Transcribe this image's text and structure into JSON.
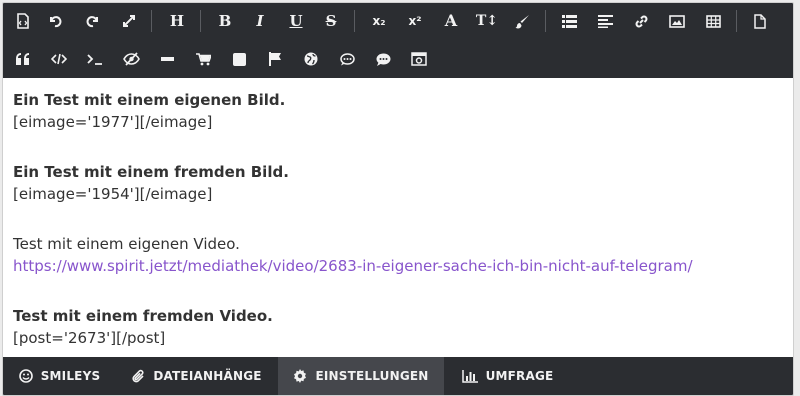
{
  "toolbar": {
    "heading_label": "H",
    "bold_label": "B",
    "italic_label": "I",
    "underline_label": "U",
    "strike_label": "S",
    "subscript_label": "x₂",
    "superscript_label": "x²",
    "font_size_label": "A",
    "text_size_label": "T↕",
    "icons_row1": [
      "source-icon",
      "undo-icon",
      "redo-icon",
      "fullscreen-icon",
      "heading-icon",
      "bold-icon",
      "italic-icon",
      "underline-icon",
      "strikethrough-icon",
      "subscript-icon",
      "superscript-icon",
      "font-size-icon",
      "text-height-icon",
      "paint-brush-icon",
      "list-icon",
      "align-left-icon",
      "link-icon",
      "image-icon",
      "table-icon",
      "page-icon"
    ],
    "icons_row2": [
      "quote-icon",
      "code-icon",
      "terminal-icon",
      "spoiler-eye-slash-icon",
      "horizontal-rule-icon",
      "shopping-cart-icon",
      "square-icon",
      "flag-icon",
      "globe-icon",
      "comment-dots-icon",
      "comment-icon",
      "media-icon"
    ]
  },
  "content": {
    "line1": "Ein Test mit einem eigenen Bild.",
    "line2": "[eimage='1977'][/eimage]",
    "line3": "Ein Test mit einem fremden Bild.",
    "line4": "[eimage='1954'][/eimage]",
    "line5": "Test mit einem eigenen Video.",
    "line6": "https://www.spirit.jetzt/mediathek/video/2683-in-eigener-sache-ich-bin-nicht-auf-telegram/",
    "line7": "Test mit einem fremden Video.",
    "line8": "[post='2673'][/post]"
  },
  "tabs": {
    "smileys": "SMILEYS",
    "attachments": "DATEIANHÄNGE",
    "settings": "EINSTELLUNGEN",
    "poll": "UMFRAGE",
    "active": "EINSTELLUNGEN"
  },
  "colors": {
    "toolbar_bg": "#2b2d31",
    "active_tab_bg": "#45474c",
    "link": "#8855cc",
    "text": "#333333"
  }
}
